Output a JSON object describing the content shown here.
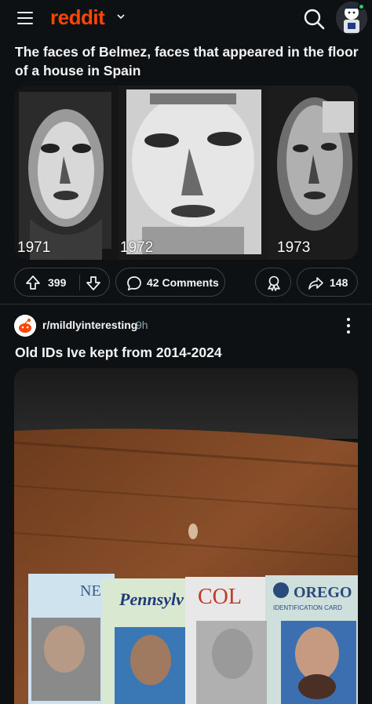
{
  "header": {
    "logo_text": "reddit",
    "menu_icon": "hamburger-menu-icon",
    "search_icon": "search-icon",
    "avatar_icon": "user-avatar",
    "brand_color": "#ff4500"
  },
  "post1": {
    "title": "The faces of Belmez, faces that appeared in the floor of a house in Spain",
    "image_years": [
      "1971",
      "1972",
      "1973"
    ],
    "upvotes": "399",
    "comments_label": "42 Comments",
    "shares": "148"
  },
  "post2": {
    "subreddit": "r/mildlyinteresting",
    "time": "9h",
    "title": "Old IDs Ive kept from 2014-2024",
    "card_texts": [
      "NE",
      "Pennsylv",
      "COL",
      "OREGO",
      "IDENTIFICATION CARD"
    ]
  }
}
